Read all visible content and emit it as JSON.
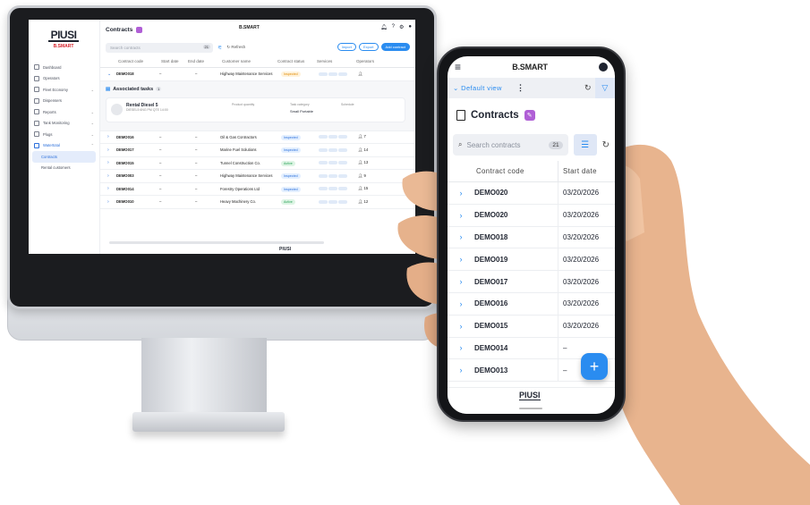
{
  "desktop": {
    "title": "Contracts",
    "brand": "B.SMART",
    "logo": "PIUSI",
    "logo_sub": "B.SMART",
    "search_placeholder": "Search contracts",
    "search_count": "21",
    "refresh_label": "Refresh",
    "buttons": {
      "import": "Import",
      "export": "Export",
      "add": "Add contract"
    },
    "nav": [
      {
        "label": "Dashboard"
      },
      {
        "label": "Operators"
      },
      {
        "label": "Fleet Economy"
      },
      {
        "label": "Dispensers"
      },
      {
        "label": "Reports"
      },
      {
        "label": "Tank Monitoring"
      },
      {
        "label": "Plugs"
      },
      {
        "label": "Watertotal"
      },
      {
        "label": "Contracts"
      },
      {
        "label": "Rental customers"
      }
    ],
    "columns": [
      "Contract code",
      "Start date",
      "End date",
      "Customer name",
      "Contract status",
      "Services",
      "Operators"
    ],
    "expanded_row": {
      "code": "DEMO018",
      "start": "–",
      "end": "–",
      "customer": "Highway Maintenance Services",
      "status": "Inspected"
    },
    "associated_tasks": {
      "label": "Associated tasks",
      "count": "1",
      "item": {
        "name": "Rental Diesel 5",
        "sub": "DIESEL5 6NG PM QTE 14:00",
        "quantity_label": "Product quantity",
        "task_label": "Task category",
        "task_value": "Small Portable",
        "schedule_label": "Schedule"
      }
    },
    "rows": [
      {
        "code": "DEMO016",
        "start": "–",
        "end": "–",
        "customer": "Oil & Gas Contractors",
        "status": "Inspected",
        "ops": "7"
      },
      {
        "code": "DEMO017",
        "start": "–",
        "end": "–",
        "customer": "Marine Fuel Solutions",
        "status": "Inspected",
        "ops": "14"
      },
      {
        "code": "DEMO015",
        "start": "–",
        "end": "–",
        "customer": "Tunnel Construction Co.",
        "status": "Active",
        "ops": "13"
      },
      {
        "code": "DEMO003",
        "start": "–",
        "end": "–",
        "customer": "Highway Maintenance Services",
        "status": "Inspected",
        "ops": "9"
      },
      {
        "code": "DEMO014",
        "start": "–",
        "end": "–",
        "customer": "Forestry Operations Ltd",
        "status": "Inspected",
        "ops": "15"
      },
      {
        "code": "DEMO010",
        "start": "–",
        "end": "–",
        "customer": "Heavy Machinery Co.",
        "status": "Active",
        "ops": "12"
      }
    ],
    "footer_logo": "PIUSI"
  },
  "mobile": {
    "brand": "B.SMART",
    "view_label": "Default view",
    "title": "Contracts",
    "search_placeholder": "Search contracts",
    "search_count": "21",
    "columns": {
      "code": "Contract code",
      "start": "Start date"
    },
    "rows": [
      {
        "code": "DEMO020",
        "start": "03/20/2026"
      },
      {
        "code": "DEMO020",
        "start": "03/20/2026"
      },
      {
        "code": "DEMO018",
        "start": "03/20/2026"
      },
      {
        "code": "DEMO019",
        "start": "03/20/2026"
      },
      {
        "code": "DEMO017",
        "start": "03/20/2026"
      },
      {
        "code": "DEMO016",
        "start": "03/20/2026"
      },
      {
        "code": "DEMO015",
        "start": "03/20/2026"
      },
      {
        "code": "DEMO014",
        "start": "–"
      },
      {
        "code": "DEMO013",
        "start": "–"
      }
    ],
    "fab": "+",
    "footer_logo": "PIUSI"
  },
  "colors": {
    "accent": "#2a8cf0",
    "brand_red": "#d4202a",
    "badge": "#b05fd6"
  }
}
